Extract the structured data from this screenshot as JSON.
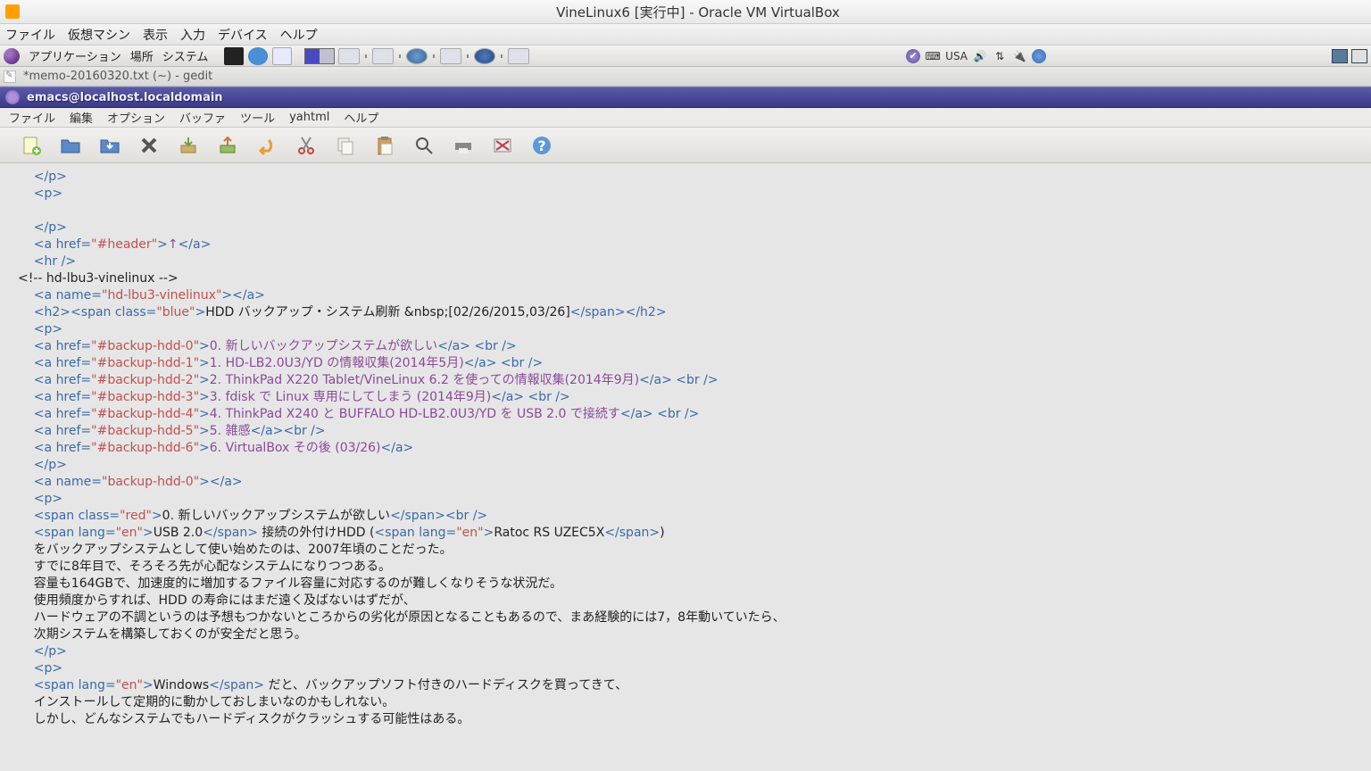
{
  "vbox": {
    "title": "VineLinux6 [実行中] - Oracle VM VirtualBox",
    "menu": [
      "ファイル",
      "仮想マシン",
      "表示",
      "入力",
      "デバイス",
      "ヘルプ"
    ]
  },
  "gnome": {
    "menus": [
      "アプリケーション",
      "場所",
      "システム"
    ],
    "kb_indicator": "USA"
  },
  "gedit": {
    "title": "*memo-20160320.txt (~) - gedit"
  },
  "emacs": {
    "title": "emacs@localhost.localdomain",
    "menu": [
      "ファイル",
      "編集",
      "オプション",
      "バッファ",
      "ツール",
      "yahtml",
      "ヘルプ"
    ]
  },
  "code": {
    "l1_a": "    </p>",
    "l2_a": "    <p>",
    "l4_a": "    </p>",
    "l5_a": "    <a ",
    "l5_b": "href=",
    "l5_c": "\"#header\"",
    "l5_d": ">",
    "l5_e": "↑",
    "l5_f": "</a>",
    "l6_a": "    <hr />",
    "l7_a": "<!-- hd-lbu3-vinelinux -->",
    "l8_a": "    <a ",
    "l8_b": "name=",
    "l8_c": "\"hd-lbu3-vinelinux\"",
    "l8_d": "></a>",
    "l9_a": "    <h2><span ",
    "l9_b": "class=",
    "l9_c": "\"blue\"",
    "l9_d": ">",
    "l9_e": "HDD バックアップ・システム刷新 &nbsp;[02/26/2015,03/26]",
    "l9_f": "</span></h2>",
    "l10_a": "    <p>",
    "l11_a": "    <a ",
    "l11_b": "href=",
    "l11_c": "\"#backup-hdd-0\"",
    "l11_d": ">",
    "l11_e": "0. 新しいバックアップシステムが欲しい",
    "l11_f": "</a>",
    "l11_g": " <br />",
    "l12_a": "    <a ",
    "l12_b": "href=",
    "l12_c": "\"#backup-hdd-1\"",
    "l12_d": ">",
    "l12_e": "1. HD-LB2.0U3/YD の情報収集(2014年5月)",
    "l12_f": "</a>",
    "l12_g": " <br />",
    "l13_a": "    <a ",
    "l13_b": "href=",
    "l13_c": "\"#backup-hdd-2\"",
    "l13_d": ">",
    "l13_e": "2. ThinkPad X220 Tablet/VineLinux 6.2 を使っての情報収集(2014年9月)",
    "l13_f": "</a>",
    "l13_g": " <br />",
    "l14_a": "    <a ",
    "l14_b": "href=",
    "l14_c": "\"#backup-hdd-3\"",
    "l14_d": ">",
    "l14_e": "3. fdisk で Linux 専用にしてしまう (2014年9月)",
    "l14_f": "</a>",
    "l14_g": " <br />",
    "l15_a": "    <a ",
    "l15_b": "href=",
    "l15_c": "\"#backup-hdd-4\"",
    "l15_d": ">",
    "l15_e": "4. ThinkPad X240 と BUFFALO HD-LB2.0U3/YD を USB 2.0 で接続す",
    "l15_f": "</a>",
    "l15_g": " <br />",
    "l16_a": "    <a ",
    "l16_b": "href=",
    "l16_c": "\"#backup-hdd-5\"",
    "l16_d": ">",
    "l16_e": "5. 雑感",
    "l16_f": "</a><br />",
    "l17_a": "    <a ",
    "l17_b": "href=",
    "l17_c": "\"#backup-hdd-6\"",
    "l17_d": ">",
    "l17_e": "6. VirtualBox その後 (03/26)",
    "l17_f": "</a>",
    "l18_a": "    </p>",
    "l19_a": "    <a ",
    "l19_b": "name=",
    "l19_c": "\"backup-hdd-0\"",
    "l19_d": "></a>",
    "l20_a": "    <p>",
    "l21_a": "    <span ",
    "l21_b": "class=",
    "l21_c": "\"red\"",
    "l21_d": ">",
    "l21_e": "0. 新しいバックアップシステムが欲しい",
    "l21_f": "</span><br />",
    "l22_a": "    <span ",
    "l22_b": "lang=",
    "l22_c": "\"en\"",
    "l22_d": ">",
    "l22_e": "USB 2.0",
    "l22_f": "</span>",
    "l22_g": " 接続の外付けHDD (",
    "l22_h": "<span ",
    "l22_i": "lang=",
    "l22_j": "\"en\"",
    "l22_k": ">",
    "l22_l": "Ratoc RS UZEC5X",
    "l22_m": "</span>",
    "l22_n": ")",
    "l23_a": "    をバックアップシステムとして使い始めたのは、2007年頃のことだった。",
    "l24_a": "    すでに8年目で、そろそろ先が心配なシステムになりつつある。",
    "l25_a": "    容量も164GBで、加速度的に増加するファイル容量に対応するのが難しくなりそうな状況だ。",
    "l26_a": "    使用頻度からすれば、HDD の寿命にはまだ遠く及ばないはずだが、",
    "l27_a": "    ハードウェアの不調というのは予想もつかないところからの劣化が原因となることもあるので、まあ経験的には7，8年動いていたら、",
    "l28_a": "    次期システムを構築しておくのが安全だと思う。",
    "l29_a": "    </p>",
    "l30_a": "    <p>",
    "l31_a": "    <span ",
    "l31_b": "lang=",
    "l31_c": "\"en\"",
    "l31_d": ">",
    "l31_e": "Windows",
    "l31_f": "</span>",
    "l31_g": " だと、バックアップソフト付きのハードディスクを買ってきて、",
    "l32_a": "    インストールして定期的に動かしておしまいなのかもしれない。",
    "l33_a": "    しかし、どんなシステムでもハードディスクがクラッシュする可能性はある。"
  }
}
